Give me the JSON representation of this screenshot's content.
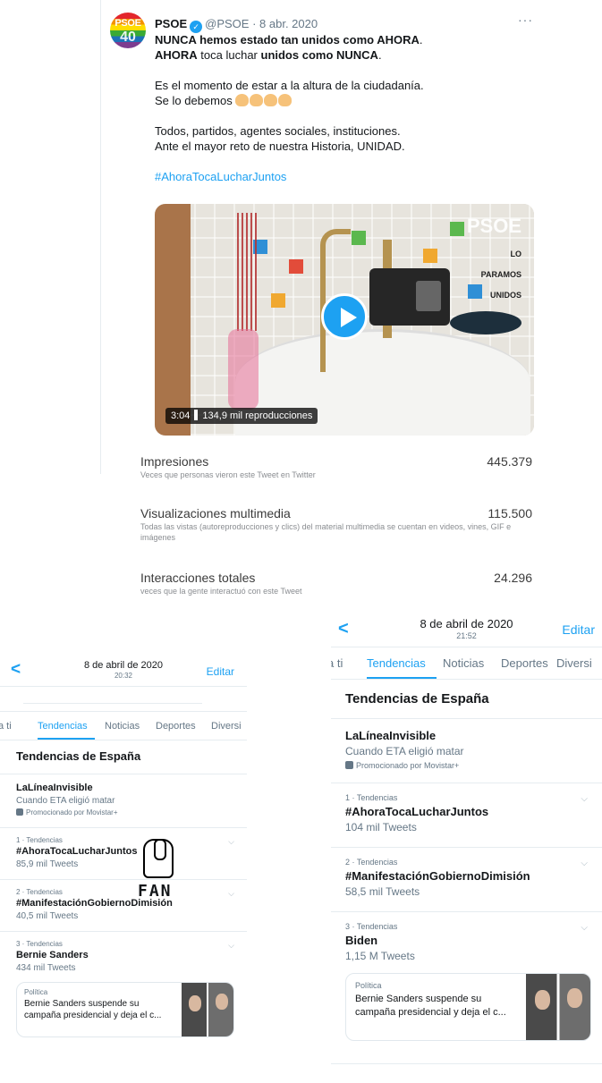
{
  "tweet": {
    "name": "PSOE",
    "handle": "@PSOE",
    "separator": "·",
    "date": "8 abr. 2020",
    "avatar_text": "PSOE",
    "avatar_number": "40",
    "line1_bold": "NUNCA hemos estado tan unidos como AHORA",
    "line1_end": ".",
    "line2_a": "AHORA",
    "line2_b": " toca luchar ",
    "line2_c": "unidos como NUNCA",
    "line2_end": ".",
    "line3": "Es el momento de estar a la altura de la ciudadanía.",
    "line4": "Se lo debemos",
    "line5": "Todos, partidos, agentes sociales, instituciones.",
    "line6": "Ante el mayor reto de nuestra Historia, UNIDAD.",
    "hashtag": "#AhoraTocaLucharJuntos",
    "more_icon": "more-icon",
    "video": {
      "duration": "3:04",
      "views": "134,9 mil reproducciones",
      "logo_top": "PSOE",
      "logo_bottom_1": "LO",
      "logo_bottom_2": "PARAMOS",
      "logo_bottom_3": "UNIDOS"
    }
  },
  "stats": [
    {
      "label": "Impresiones",
      "value": "445.379",
      "desc": "Veces que personas vieron este Tweet en Twitter"
    },
    {
      "label": "Visualizaciones multimedia",
      "value": "115.500",
      "desc": "Todas las vistas (autoreproducciones y clics) del material multimedia se cuentan en videos, vines, GIF e imágenes"
    },
    {
      "label": "Interacciones totales",
      "value": "24.296",
      "desc": "veces que la gente interactuó con este Tweet"
    }
  ],
  "phone_left": {
    "back": "<",
    "date": "8 de abril de 2020",
    "time": "20:32",
    "edit": "Editar",
    "tabs": [
      "a ti",
      "Tendencias",
      "Noticias",
      "Deportes",
      "Diversi"
    ],
    "section": "Tendencias de España",
    "promoted": {
      "name": "LaLíneaInvisible",
      "sub": "Cuando ETA eligió matar",
      "promo": "Promocionado por Movistar+"
    },
    "trends": [
      {
        "cat": "1 · Tendencias",
        "name": "#AhoraTocaLucharJuntos",
        "sub": "85,9 mil Tweets"
      },
      {
        "cat": "2 · Tendencias",
        "name": "#ManifestaciónGobiernoDimisión",
        "sub": "40,5 mil Tweets"
      },
      {
        "cat": "3 · Tendencias",
        "name": "Bernie Sanders",
        "sub": "434 mil Tweets"
      }
    ],
    "news": {
      "cat": "Política",
      "title": "Bernie Sanders suspende su campaña presidencial y deja el c..."
    },
    "sticker_text": "FAN"
  },
  "phone_right": {
    "back": "<",
    "date": "8 de abril de 2020",
    "time": "21:52",
    "edit": "Editar",
    "tabs": [
      "a ti",
      "Tendencias",
      "Noticias",
      "Deportes",
      "Diversi"
    ],
    "section": "Tendencias de España",
    "promoted": {
      "name": "LaLíneaInvisible",
      "sub": "Cuando ETA eligió matar",
      "promo": "Promocionado por Movistar+"
    },
    "trends": [
      {
        "cat": "1 · Tendencias",
        "name": "#AhoraTocaLucharJuntos",
        "sub": "104 mil Tweets"
      },
      {
        "cat": "2 · Tendencias",
        "name": "#ManifestaciónGobiernoDimisión",
        "sub": "58,5 mil Tweets"
      },
      {
        "cat": "3 · Tendencias",
        "name": "Biden",
        "sub": "1,15 M Tweets"
      }
    ],
    "news": {
      "cat": "Política",
      "title": "Bernie Sanders suspende su campaña presidencial y deja el c..."
    }
  },
  "colors": {
    "accent": "#1da1f2",
    "text": "#14171a",
    "muted": "#657786"
  }
}
